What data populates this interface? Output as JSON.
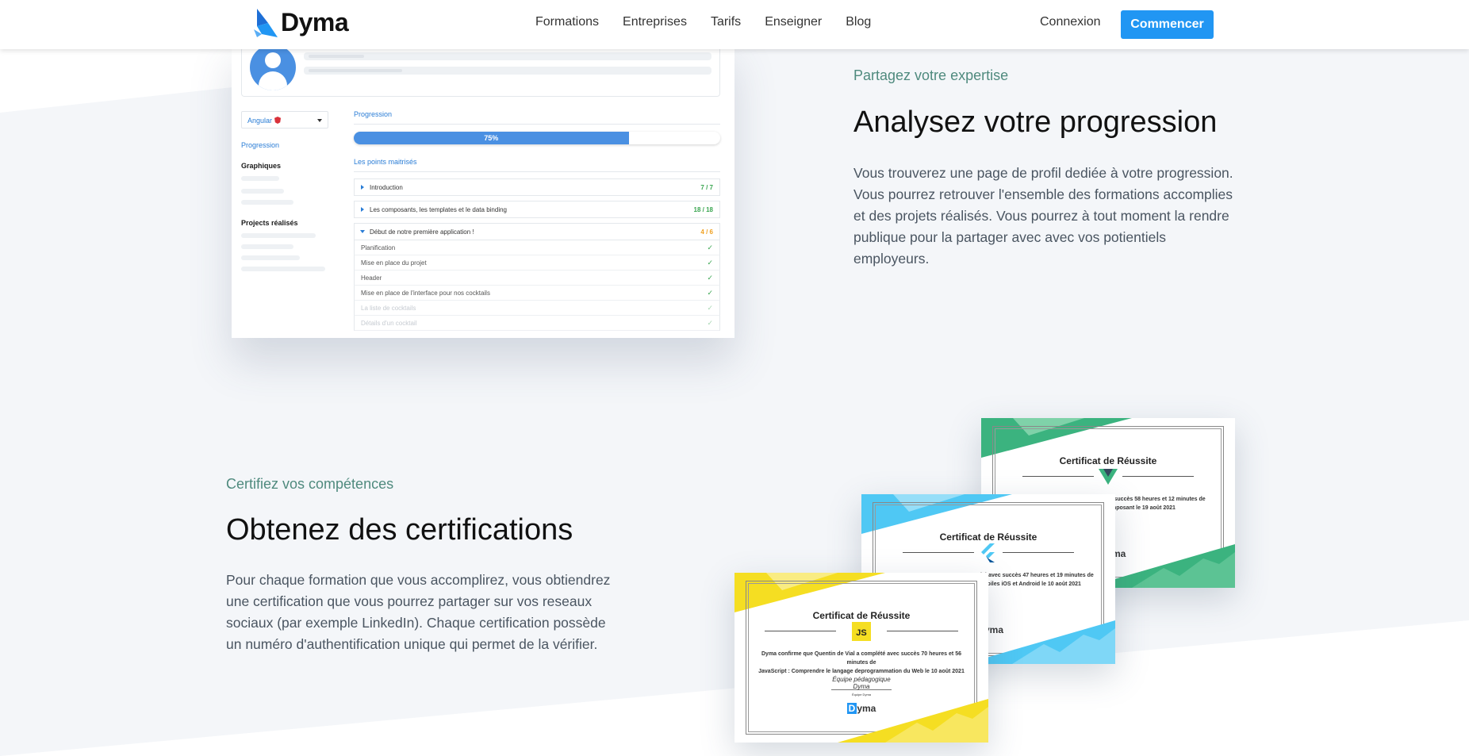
{
  "header": {
    "brand": "Dyma",
    "nav": [
      "Formations",
      "Entreprises",
      "Tarifs",
      "Enseigner",
      "Blog"
    ],
    "login_label": "Connexion",
    "cta_label": "Commencer"
  },
  "colors": {
    "accent": "#2196f3",
    "eyebrow": "#4f8a7e",
    "progress_fill": "#4a90e2",
    "success": "#3aa651",
    "warning": "#f0a020",
    "cert_green": "#3bb37f",
    "cert_blue": "#4fc8f4",
    "cert_yellow": "#f5de22"
  },
  "mockup": {
    "course_select": "Angular",
    "sidebar": {
      "progression": "Progression",
      "graphiques": "Graphiques",
      "projects": "Projects réalisés"
    },
    "progress_title": "Progression",
    "progress_percent": 75,
    "progress_label": "75%",
    "points_title": "Les points maitrisés",
    "chapters": [
      {
        "label": "Introduction",
        "count": "7 / 7",
        "status": "complete",
        "expanded": false
      },
      {
        "label": "Les composants, les templates et le data binding",
        "count": "18 / 18",
        "status": "complete",
        "expanded": false
      },
      {
        "label": "Début de notre première application !",
        "count": "4 / 6",
        "status": "partial",
        "expanded": true
      }
    ],
    "lessons": [
      {
        "label": "Planification",
        "done": true
      },
      {
        "label": "Mise en place du projet",
        "done": true
      },
      {
        "label": "Header",
        "done": true
      },
      {
        "label": "Mise en place de l'interface pour nos cocktails",
        "done": true
      },
      {
        "label": "La liste de cocktails",
        "done": false
      },
      {
        "label": "Détails d'un cocktail",
        "done": false
      }
    ]
  },
  "section_progress": {
    "eyebrow": "Partagez votre expertise",
    "heading": "Analysez votre progression",
    "body": "Vous trouverez une page de profil dediée à votre progression. Vous pourrez retrouver l'ensemble des formations accomplies et des projets réalisés. Vous pourrez à tout moment la rendre publique pour la partager avec avec vos potientiels employeurs."
  },
  "section_cert": {
    "eyebrow": "Certifiez vos compétences",
    "heading": "Obtenez des certifications",
    "body": "Pour chaque formation que vous accomplirez, vous obtiendrez une certification que vous pourrez partager sur vos reseaux sociaux (par exemple LinkedIn). Chaque certification possède un numéro d'authentification unique qui permet de la vérifier."
  },
  "certificates": [
    {
      "title": "Certificat de Réussite",
      "icon": "vue-logo",
      "text": "avec succès 58 heures et 12 minutes de\né composant le 19 août 2021",
      "brand": "ma"
    },
    {
      "title": "Certificat de Réussite",
      "icon": "flutter-logo",
      "text": "ité avec succès 47 heures et 19 minutes de\nnobiles iOS et Android le 10 août 2021",
      "brand": "yma"
    },
    {
      "title": "Certificat de Réussite",
      "icon": "js-logo",
      "badge_text": "JS",
      "text": "Dyma confirme que Quentin de Vial a complété avec succès 70 heures et 56 minutes de\nJavaScript : Comprendre le langage deprogrammation du Web le 10 août 2021",
      "signature": "Équipe pédagogique Dyma",
      "signature_caption": "Équipe Dyma",
      "brand_mark": "D",
      "brand_rest": "yma"
    }
  ]
}
